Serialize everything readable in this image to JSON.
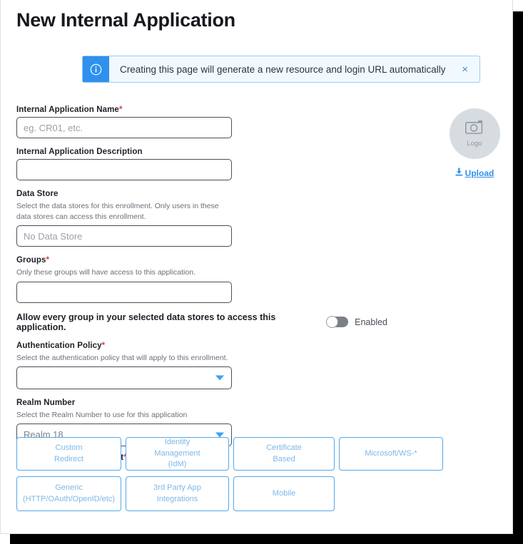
{
  "page": {
    "title": "New Internal Application"
  },
  "banner": {
    "icon": "info-circle-icon",
    "message": "Creating this page will generate a new resource and login URL automatically",
    "close_label": "×",
    "accent_color": "#2f90ed",
    "background_color": "#f2f9fe",
    "border_color": "#96cdf5"
  },
  "form": {
    "app_name": {
      "label": "Internal Application Name",
      "required_marker": "*",
      "value": "",
      "placeholder": "eg. CR01, etc."
    },
    "app_description": {
      "label": "Internal Application Description",
      "value": "",
      "placeholder": ""
    },
    "data_store": {
      "label": "Data Store",
      "helper": "Select the data stores for this enrollment. Only users in these data stores can access this enrollment.",
      "value": "",
      "placeholder": "No Data Store"
    },
    "groups": {
      "label": "Groups",
      "required_marker": "*",
      "helper": "Only these groups will have access to this application.",
      "value": "",
      "placeholder": ""
    },
    "allow_all_groups": {
      "label": "Allow every group in your selected data stores to access this application.",
      "state_label": "Enabled",
      "enabled": false
    },
    "auth_policy": {
      "label": "Authentication Policy",
      "required_marker": "*",
      "helper": "Select the authentication policy that will apply to this enrollment.",
      "selected": ""
    },
    "realm_number": {
      "label": "Realm Number",
      "helper": "Select the Realm Number to use for this application",
      "selected": "Realm 18"
    },
    "authenticate_user_redirect": {
      "label": "Authenticate User Redirect",
      "required_marker": "*",
      "options": [
        {
          "label": "Custom\nRedirect",
          "line1": "Custom",
          "line2": "Redirect",
          "line3": ""
        },
        {
          "label": "Identity Management (IdM)",
          "line1": "Identity",
          "line2": "Management",
          "line3": "(IdM)"
        },
        {
          "label": "Certificate Based",
          "line1": "Certificate",
          "line2": "Based",
          "line3": ""
        },
        {
          "label": "Microsoft/WS-*",
          "line1": "Microsoft/WS-*",
          "line2": "",
          "line3": ""
        },
        {
          "label": "Generic (HTTP/OAuth/OpenID/etc)",
          "line1": "Generic",
          "line2": "(HTTP/OAuth/OpenID/etc)",
          "line3": ""
        },
        {
          "label": "3rd Party App Integrations",
          "line1": "3rd Party App",
          "line2": "Integrations",
          "line3": ""
        },
        {
          "label": "Mobile",
          "line1": "Mobile",
          "line2": "",
          "line3": ""
        }
      ]
    }
  },
  "logo": {
    "placeholder_icon": "camera-icon",
    "caption": "Logo",
    "upload_label": "Upload",
    "upload_icon": "download-arrow-icon",
    "link_color": "#2f90ed"
  }
}
